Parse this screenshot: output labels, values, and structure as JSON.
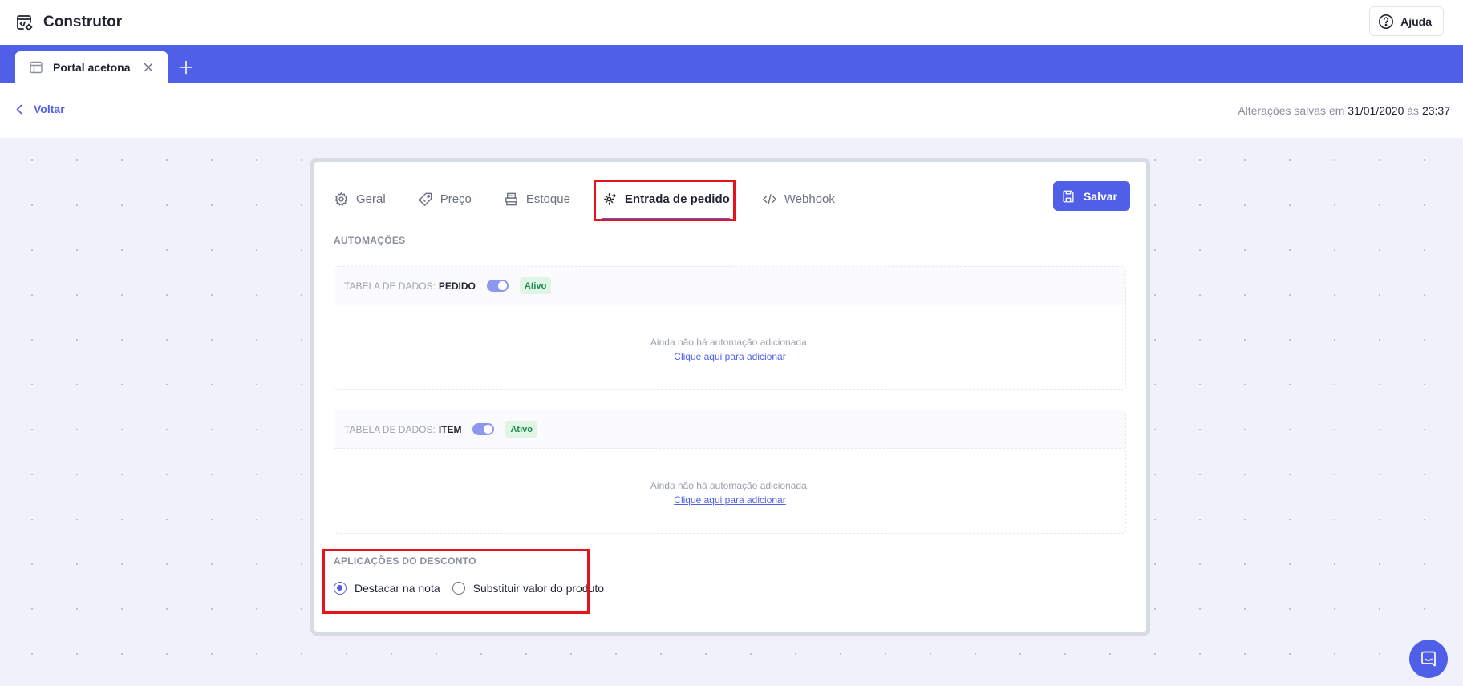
{
  "app": {
    "title": "Construtor",
    "help_label": "Ajuda"
  },
  "doc_tabs": [
    {
      "label": "Portal acetona"
    }
  ],
  "subheader": {
    "back_label": "Voltar",
    "saved_prefix": "Alterações salvas em",
    "saved_date": "31/01/2020",
    "saved_sep": "às",
    "saved_time": "23:37"
  },
  "settings_tabs": [
    {
      "label": "Geral",
      "icon": "gear-icon"
    },
    {
      "label": "Preço",
      "icon": "tag-icon"
    },
    {
      "label": "Estoque",
      "icon": "stock-icon"
    },
    {
      "label": "Entrada de pedido",
      "icon": "order-entry-icon",
      "active": true
    },
    {
      "label": "Webhook",
      "icon": "code-icon"
    }
  ],
  "save_label": "Salvar",
  "automations": {
    "section_label": "AUTOMAÇÕES",
    "tables": [
      {
        "prefix": "TABELA DE DADOS:",
        "name": "PEDIDO",
        "enabled": true,
        "status": "Ativo",
        "empty_text": "Ainda não há automação adicionada.",
        "add_link": "Clique aqui para adicionar"
      },
      {
        "prefix": "TABELA DE DADOS:",
        "name": "ITEM",
        "enabled": true,
        "status": "Ativo",
        "empty_text": "Ainda não há automação adicionada.",
        "add_link": "Clique aqui para adicionar"
      }
    ]
  },
  "discount": {
    "section_label": "APLICAÇÕES DO DESCONTO",
    "options": [
      {
        "label": "Destacar na nota",
        "selected": true
      },
      {
        "label": "Substituir valor do produto",
        "selected": false
      }
    ]
  },
  "colors": {
    "accent": "#4f5fe8",
    "highlight": "#e8121b",
    "active_badge_bg": "#dff5e6",
    "active_badge_text": "#1f8a4c"
  }
}
